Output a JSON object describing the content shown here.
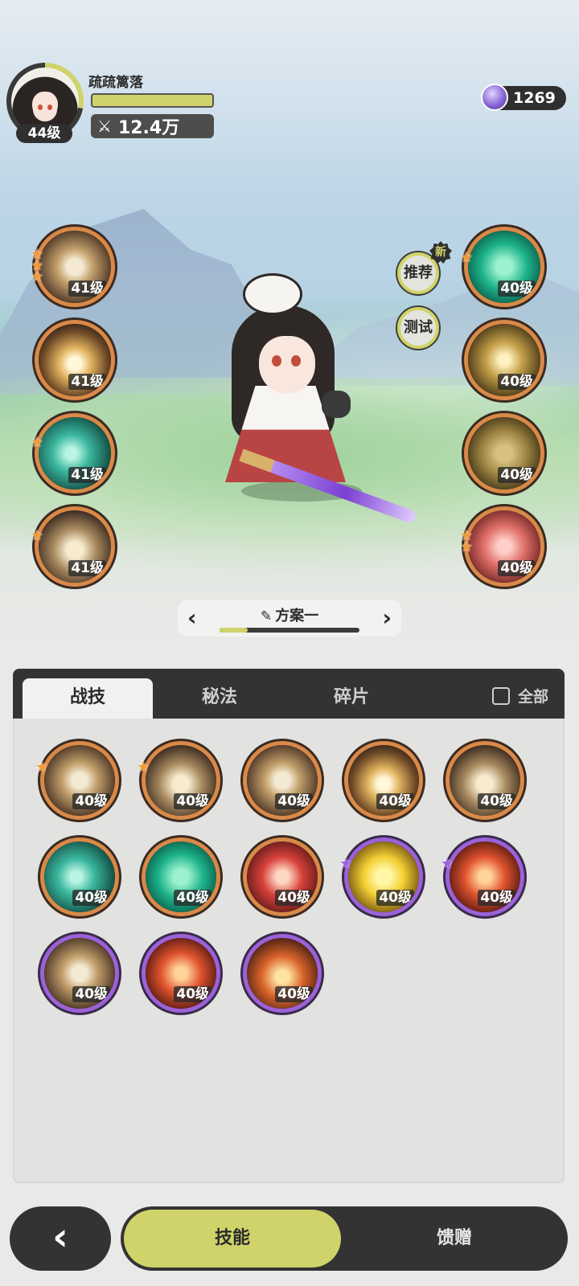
{
  "player": {
    "name": "疏疏篱落",
    "level": "44级",
    "power": "12.4万"
  },
  "currency": {
    "amount": "1269",
    "icon": "gem-icon"
  },
  "side_buttons": {
    "recommend": "推荐",
    "new_badge": "新",
    "test": "测试"
  },
  "left_skills": [
    {
      "level": "41级",
      "stars": 3,
      "icon": "tan"
    },
    {
      "level": "41级",
      "stars": 0,
      "icon": "burst"
    },
    {
      "level": "41级",
      "stars": 1,
      "icon": "teal"
    },
    {
      "level": "41级",
      "stars": 1,
      "icon": "spikes"
    }
  ],
  "right_skills": [
    {
      "level": "40级",
      "stars": 1,
      "icon": "green"
    },
    {
      "level": "40级",
      "stars": 0,
      "icon": "eye"
    },
    {
      "level": "40级",
      "stars": 0,
      "icon": "armor"
    },
    {
      "level": "40级",
      "stars": 2,
      "icon": "red"
    }
  ],
  "loadout": {
    "name": "方案一",
    "progress": 0.2
  },
  "tabs": {
    "battle": "战技",
    "secret": "秘法",
    "fragment": "碎片",
    "all_filter": "全部"
  },
  "skill_grid": [
    {
      "level": "40级",
      "star": "orange",
      "rarity": "orange",
      "icon": "tan"
    },
    {
      "level": "40级",
      "star": "orange",
      "rarity": "orange",
      "icon": "spikes"
    },
    {
      "level": "40级",
      "star": "",
      "rarity": "orange",
      "icon": "tan"
    },
    {
      "level": "40级",
      "star": "",
      "rarity": "orange",
      "icon": "burst"
    },
    {
      "level": "40级",
      "star": "",
      "rarity": "orange",
      "icon": "spikes"
    },
    {
      "level": "40级",
      "star": "",
      "rarity": "orange",
      "icon": "teal"
    },
    {
      "level": "40级",
      "star": "",
      "rarity": "orange",
      "icon": "green"
    },
    {
      "level": "40级",
      "star": "",
      "rarity": "orange",
      "icon": "crimson"
    },
    {
      "level": "40级",
      "star": "purple",
      "rarity": "purple",
      "icon": "gold"
    },
    {
      "level": "40级",
      "star": "purple",
      "rarity": "purple",
      "icon": "fire"
    },
    {
      "level": "40级",
      "star": "",
      "rarity": "purple",
      "icon": "tan"
    },
    {
      "level": "40级",
      "star": "",
      "rarity": "purple",
      "icon": "fire"
    },
    {
      "level": "40级",
      "star": "",
      "rarity": "purple",
      "icon": "ember"
    }
  ],
  "bottom_nav": {
    "skills": "技能",
    "gift": "馈赠"
  }
}
